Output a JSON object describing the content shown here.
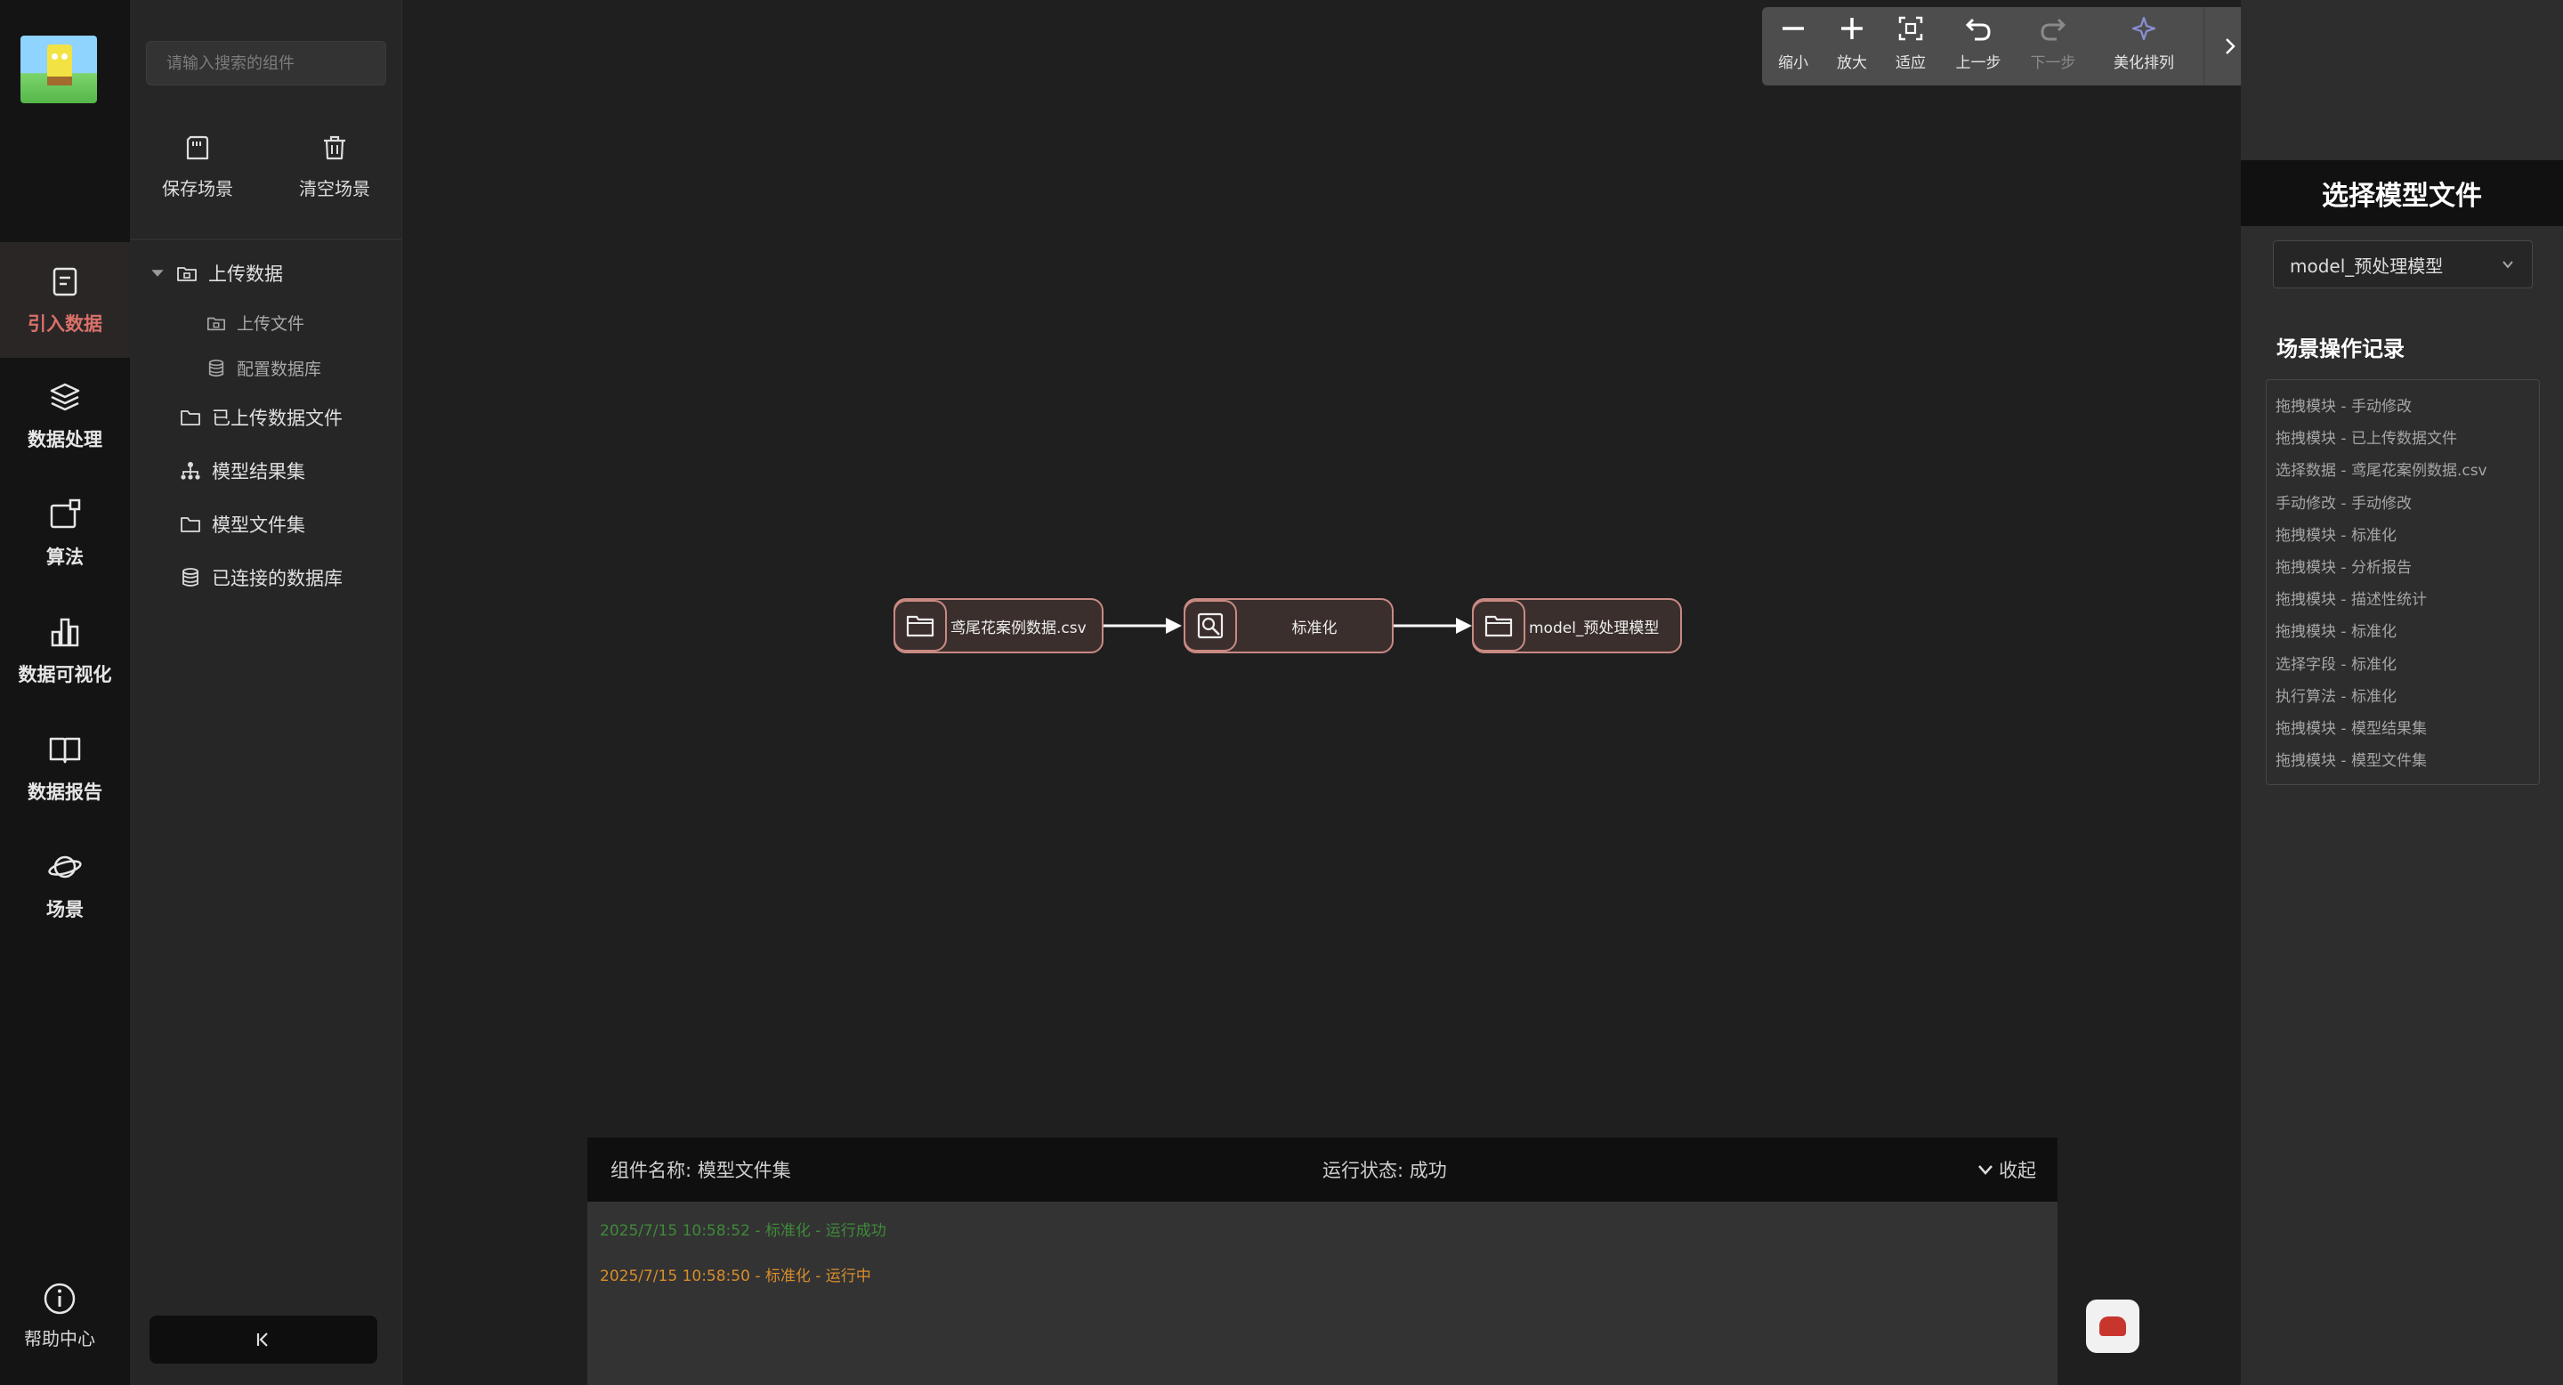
{
  "nav": {
    "items": [
      {
        "label": "引入数据",
        "icon": "clipboard-icon"
      },
      {
        "label": "数据处理",
        "icon": "layers-icon"
      },
      {
        "label": "算法",
        "icon": "algorithm-icon"
      },
      {
        "label": "数据可视化",
        "icon": "bar-chart-icon"
      },
      {
        "label": "数据报告",
        "icon": "book-icon"
      },
      {
        "label": "场景",
        "icon": "planet-icon"
      }
    ],
    "help": "帮助中心"
  },
  "panel": {
    "search_placeholder": "请输入搜索的组件",
    "save_scene": "保存场景",
    "clear_scene": "清空场景",
    "tree": {
      "upload_data": "上传数据",
      "upload_file": "上传文件",
      "config_db": "配置数据库",
      "uploaded_files": "已上传数据文件",
      "model_results": "模型结果集",
      "model_files": "模型文件集",
      "connected_db": "已连接的数据库"
    }
  },
  "toolbar": {
    "zoom_out": "缩小",
    "zoom_in": "放大",
    "fit": "适应",
    "undo": "上一步",
    "redo": "下一步",
    "beautify": "美化排列"
  },
  "flow": {
    "nodes": [
      {
        "name": "鸢尾花案例数据.csv"
      },
      {
        "name": "标准化"
      },
      {
        "name": "model_预处理模型"
      }
    ]
  },
  "log": {
    "component": "组件名称: 模型文件集",
    "status": "运行状态: 成功",
    "collapse": "收起",
    "lines": [
      {
        "text": "2025/7/15 10:58:52 - 标准化 - 运行成功",
        "color": "#3f8a3a"
      },
      {
        "text": "2025/7/15 10:58:50 - 标准化 - 运行中",
        "color": "#d98d2b"
      }
    ]
  },
  "right": {
    "title": "选择模型文件",
    "select_value": "model_预处理模型",
    "records_title": "场景操作记录",
    "records": [
      "拖拽模块 - 手动修改",
      "拖拽模块 - 已上传数据文件",
      "选择数据 - 鸢尾花案例数据.csv",
      "手动修改 - 手动修改",
      "拖拽模块 - 标准化",
      "拖拽模块 - 分析报告",
      "拖拽模块 - 描述性统计",
      "拖拽模块 - 标准化",
      "选择字段 - 标准化",
      "执行算法 - 标准化",
      "拖拽模块 - 模型结果集",
      "拖拽模块 - 模型文件集"
    ]
  },
  "colors": {
    "accent": "#d9706a",
    "node_border": "#c98a83",
    "success": "#3f8a3a",
    "running": "#d98d2b"
  }
}
